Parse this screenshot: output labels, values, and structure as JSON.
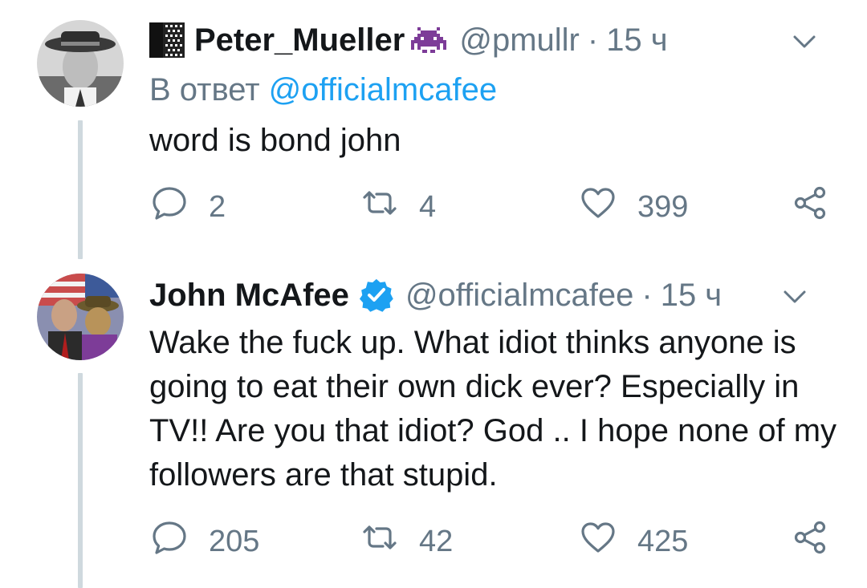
{
  "tweets": [
    {
      "display_name": "Peter_Mueller",
      "handle": "@pmullr",
      "separator": "·",
      "time": "15 ч",
      "reply_prefix": "В ответ",
      "reply_mention": "@officialmcafee",
      "text": "word is bond john",
      "replies": "2",
      "retweets": "4",
      "likes": "399",
      "icons": {
        "avatar": "avatar",
        "name_prefix": "black-flag-icon",
        "name_suffix": "space-invader-icon",
        "menu": "chevron-down-icon"
      }
    },
    {
      "display_name": "John McAfee",
      "handle": "@officialmcafee",
      "separator": "·",
      "time": "15 ч",
      "text": "Wake the fuck up. What idiot thinks anyone is going to eat their own dick ever? Especially in TV!! Are you that idiot?  God ..  I hope none of my followers are that stupid.",
      "replies": "205",
      "retweets": "42",
      "likes": "425",
      "icons": {
        "avatar": "avatar",
        "verified": "verified-badge-icon",
        "menu": "chevron-down-icon"
      }
    }
  ],
  "colors": {
    "text": "#14171a",
    "secondary": "#657786",
    "link": "#1da1f2",
    "thread_line": "#cfd9de",
    "verified": "#1da1f2",
    "emoji_purple": "#7d3c98"
  }
}
